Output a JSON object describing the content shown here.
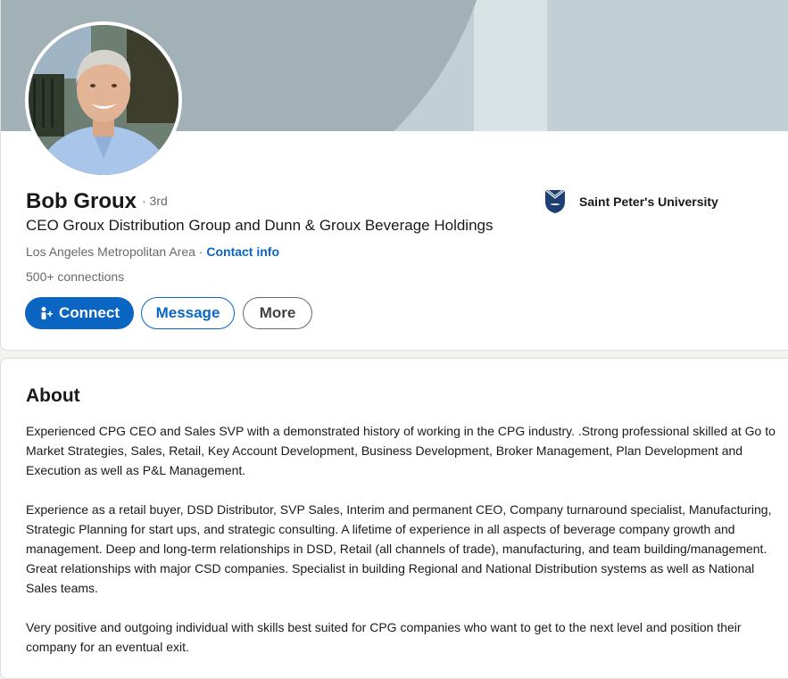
{
  "profile": {
    "name": "Bob Groux",
    "degree": "· 3rd",
    "headline": "CEO Groux Distribution Group and Dunn & Groux Beverage Holdings",
    "location": "Los Angeles Metropolitan Area",
    "separator": " · ",
    "contact_info": "Contact info",
    "connections": "500+ connections",
    "education": "Saint Peter's University"
  },
  "actions": {
    "connect": "Connect",
    "message": "Message",
    "more": "More"
  },
  "about": {
    "title": "About",
    "paragraphs": [
      "Experienced CPG CEO and Sales SVP with a demonstrated history of working in the CPG industry. .Strong professional skilled at Go to Market Strategies, Sales, Retail, Key Account Development, Business Development, Broker Management, Plan Development and Execution as well as P&L Management.",
      "Experience as a retail buyer, DSD Distributor, SVP Sales, Interim and permanent CEO, Company turnaround specialist, Manufacturing, Strategic Planning for start ups, and strategic consulting. A lifetime of experience in all aspects of beverage company growth and management. Deep and long-term relationships in DSD, Retail (all channels of trade), manufacturing, and team building/management. Great relationships with major CSD companies. Specialist in building Regional and National Distribution systems as well as National Sales teams.",
      "Very positive and outgoing individual with skills best suited for CPG companies who want to get to the next level and position their company for an eventual exit."
    ]
  },
  "icons": {
    "connect": "add-person-icon",
    "education": "university-shield-icon"
  },
  "colors": {
    "primary": "#0a66c2",
    "cover": "#c0d0d4",
    "cover_arc": "#a1b1b5"
  }
}
